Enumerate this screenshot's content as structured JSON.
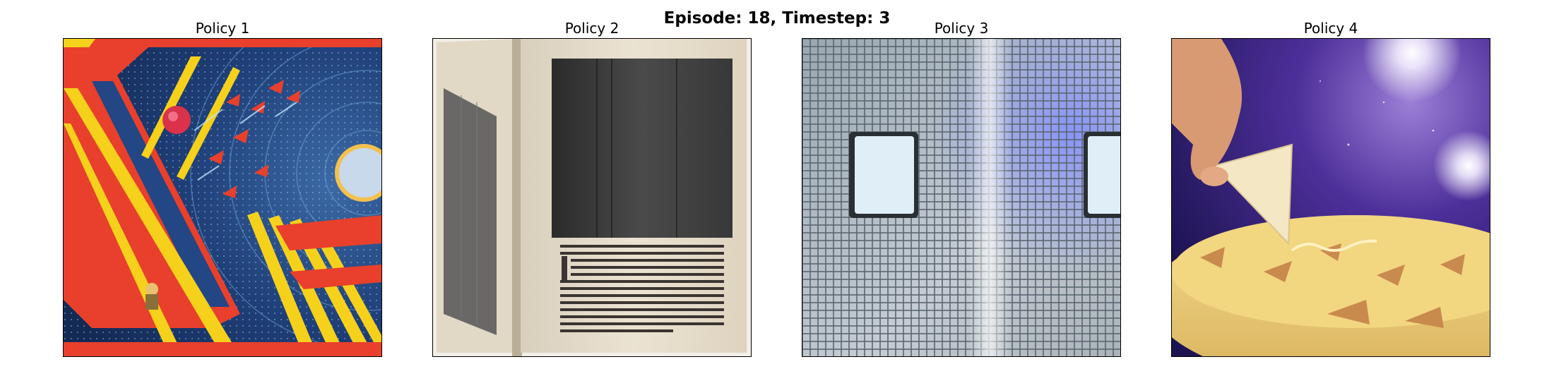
{
  "figure": {
    "title": "Episode: 18, Timestep: 3"
  },
  "panels": [
    {
      "title": "Policy 1",
      "image_subject": "retro-style illustration of spaceships flying through a space tunnel with red and yellow geometric beams"
    },
    {
      "title": "Policy 2",
      "image_subject": "open old book with a large dark printed plate and columns of text"
    },
    {
      "title": "Policy 3",
      "image_subject": "close-up of a metal mesh grid with two glowing light panels"
    },
    {
      "title": "Policy 4",
      "image_subject": "hand holding a piping cone decorating a cake against a starry purple space background"
    }
  ]
}
